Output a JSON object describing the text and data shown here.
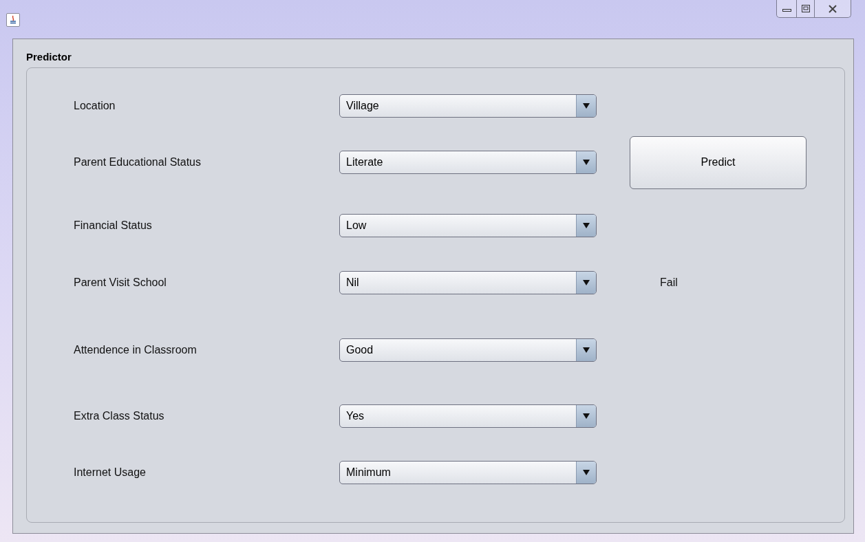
{
  "panel": {
    "title": "Predictor"
  },
  "fields": [
    {
      "label": "Location",
      "value": "Village"
    },
    {
      "label": "Parent Educational Status",
      "value": "Literate"
    },
    {
      "label": "Financial Status",
      "value": "Low"
    },
    {
      "label": "Parent Visit School",
      "value": "Nil"
    },
    {
      "label": "Attendence in Classroom",
      "value": "Good"
    },
    {
      "label": "Extra Class Status",
      "value": "Yes"
    },
    {
      "label": "Internet Usage",
      "value": "Minimum"
    }
  ],
  "predict_button": "Predict",
  "result": "Fail"
}
